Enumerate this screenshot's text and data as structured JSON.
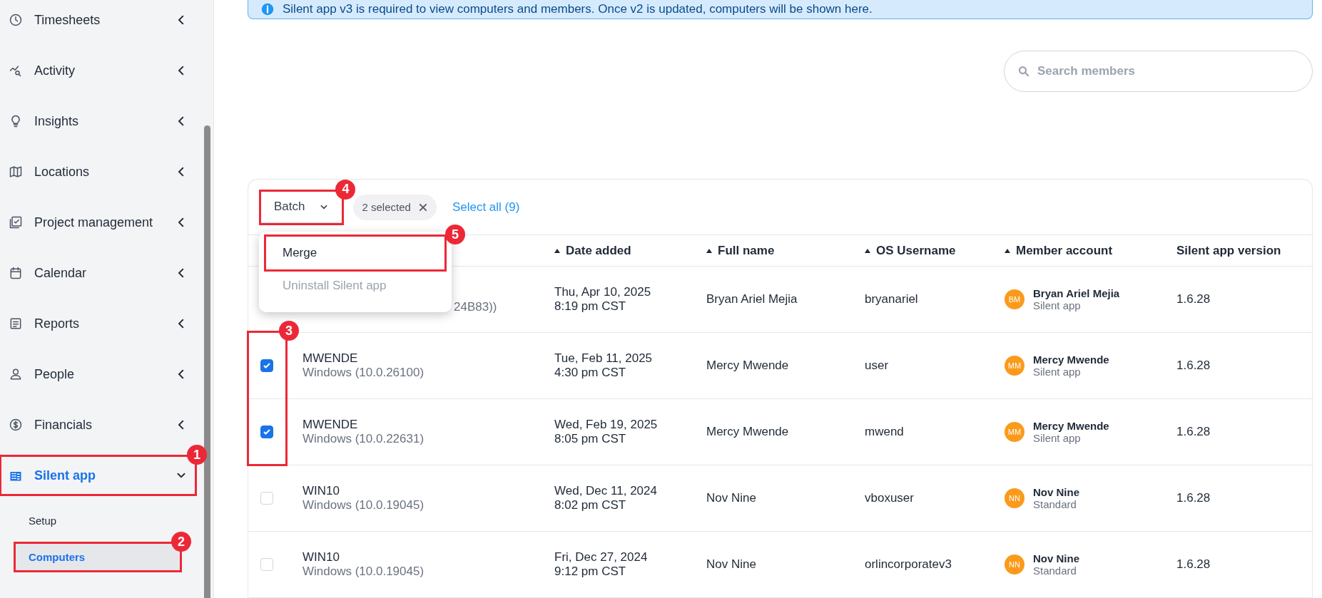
{
  "sidebar": {
    "items": [
      {
        "label": "Timesheets",
        "expanded": false,
        "selected": false
      },
      {
        "label": "Activity",
        "expanded": false,
        "selected": false
      },
      {
        "label": "Insights",
        "expanded": false,
        "selected": false
      },
      {
        "label": "Locations",
        "expanded": false,
        "selected": false
      },
      {
        "label": "Project management",
        "expanded": false,
        "selected": false
      },
      {
        "label": "Calendar",
        "expanded": false,
        "selected": false
      },
      {
        "label": "Reports",
        "expanded": false,
        "selected": false
      },
      {
        "label": "People",
        "expanded": false,
        "selected": false
      },
      {
        "label": "Financials",
        "expanded": false,
        "selected": false
      },
      {
        "label": "Silent app",
        "expanded": true,
        "selected": true,
        "annotation": "1",
        "children": [
          {
            "label": "Setup",
            "selected": false
          },
          {
            "label": "Computers",
            "selected": true,
            "annotation": "2"
          }
        ]
      }
    ]
  },
  "banner": {
    "text": "Silent app v3 is required to view computers and members. Once v2 is updated, computers will be shown here."
  },
  "search": {
    "placeholder": "Search members"
  },
  "table": {
    "batch": {
      "label": "Batch",
      "annotation": "4",
      "menu": [
        {
          "label": "Merge",
          "disabled": false,
          "annotation": "5"
        },
        {
          "label": "Uninstall Silent app",
          "disabled": true
        }
      ]
    },
    "selection_chip": "2 selected",
    "select_all": "Select all (9)",
    "checkbox_annotation": "3",
    "columns": [
      {
        "label": "Date added",
        "sortable": true
      },
      {
        "label": "Full name",
        "sortable": true
      },
      {
        "label": "OS Username",
        "sortable": true
      },
      {
        "label": "Member account",
        "sortable": true
      },
      {
        "label": "Silent app version",
        "sortable": false
      }
    ],
    "rows": [
      {
        "os": "24B83))",
        "date": "Thu, Apr 10, 2025",
        "time": "8:19 pm CST",
        "full_name": "Bryan Ariel Mejia",
        "os_username": "bryanariel",
        "member": {
          "initials": "BM",
          "name": "Bryan Ariel Mejia",
          "type": "Silent app"
        },
        "version": "1.6.28"
      },
      {
        "checked": true,
        "computer": "MWENDE",
        "os": "Windows (10.0.26100)",
        "date": "Tue, Feb 11, 2025",
        "time": "4:30 pm CST",
        "full_name": "Mercy Mwende",
        "os_username": "user",
        "member": {
          "initials": "MM",
          "name": "Mercy Mwende",
          "type": "Silent app"
        },
        "version": "1.6.28"
      },
      {
        "checked": true,
        "computer": "MWENDE",
        "os": "Windows (10.0.22631)",
        "date": "Wed, Feb 19, 2025",
        "time": "8:05 pm CST",
        "full_name": "Mercy Mwende",
        "os_username": "mwend",
        "member": {
          "initials": "MM",
          "name": "Mercy Mwende",
          "type": "Silent app"
        },
        "version": "1.6.28"
      },
      {
        "checked": false,
        "computer": "WIN10",
        "os": "Windows (10.0.19045)",
        "date": "Wed, Dec 11, 2024",
        "time": "8:02 pm CST",
        "full_name": "Nov Nine",
        "os_username": "vboxuser",
        "member": {
          "initials": "NN",
          "name": "Nov Nine",
          "type": "Standard"
        },
        "version": "1.6.28"
      },
      {
        "checked": false,
        "computer": "WIN10",
        "os": "Windows (10.0.19045)",
        "date": "Fri, Dec 27, 2024",
        "time": "9:12 pm CST",
        "full_name": "Nov Nine",
        "os_username": "orlincorporatev3",
        "member": {
          "initials": "NN",
          "name": "Nov Nine",
          "type": "Standard"
        },
        "version": "1.6.28"
      }
    ]
  }
}
